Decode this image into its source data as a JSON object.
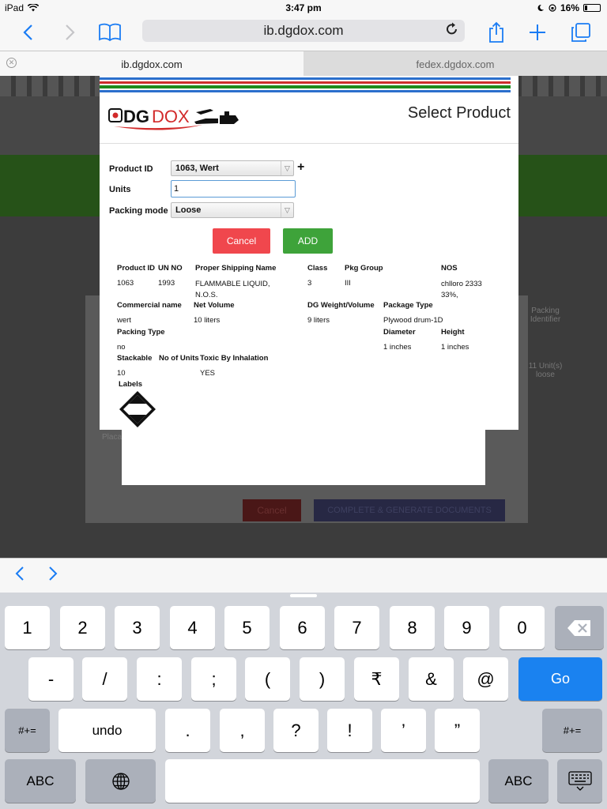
{
  "status_bar": {
    "device": "iPad",
    "wifi": "wifi-icon",
    "time": "3:47 pm",
    "battery": "16%"
  },
  "browser": {
    "url": "ib.dgdox.com",
    "tabs": [
      {
        "label": "ib.dgdox.com",
        "active": true
      },
      {
        "label": "fedex.dgdox.com",
        "active": false
      }
    ]
  },
  "background_page": {
    "packing_identifier_header": "Packing Identifier",
    "row_value": "11 Unit(s) loose",
    "placard_text": "Placa",
    "cancel": "Cancel",
    "complete": "COMPLETE & GENERATE DOCUMENTS"
  },
  "modal": {
    "logo": {
      "dg": "DG",
      "dox": "DOX"
    },
    "title": "Select Product",
    "form": {
      "product_id_label": "Product ID",
      "product_id_value": "1063, Wert",
      "units_label": "Units",
      "units_value": "1",
      "packing_mode_label": "Packing mode",
      "packing_mode_value": "Loose"
    },
    "buttons": {
      "cancel": "Cancel",
      "add": "ADD"
    },
    "details": {
      "product_id_header": "Product ID",
      "un_no_header": "UN NO",
      "shipping_name_header": "Proper Shipping Name",
      "class_header": "Class",
      "pkg_group_header": "Pkg Group",
      "nos_header": "NOS",
      "product_id": "1063",
      "un_no": "1993",
      "shipping_name": "FLAMMABLE LIQUID, N.O.S.",
      "class": "3",
      "pkg_group": "III",
      "nos": "chlloro 2333 33%,",
      "commercial_name_header": "Commercial name",
      "net_volume_header": "Net Volume",
      "dg_weight_header": "DG Weight/Volume",
      "package_type_header": "Package Type",
      "commercial_name": "wert",
      "net_volume": "10 liters",
      "dg_weight": "9 liters",
      "package_type": "Plywood drum-1D",
      "packing_type_header": "Packing Type",
      "diameter_header": "Diameter",
      "height_header": "Height",
      "packing_type": "no",
      "diameter": "1 inches",
      "height": "1 inches",
      "stackable_header": "Stackable",
      "no_of_units_header": "No of Units",
      "toxic_header": "Toxic By Inhalation",
      "stackable": "10",
      "toxic": "YES",
      "labels_header": "Labels"
    }
  },
  "keyboard": {
    "row1": [
      "1",
      "2",
      "3",
      "4",
      "5",
      "6",
      "7",
      "8",
      "9",
      "0"
    ],
    "row2": [
      "-",
      "/",
      ":",
      ";",
      "(",
      ")",
      "₹",
      "&",
      "@"
    ],
    "go": "Go",
    "row3_left": "#+=",
    "undo": "undo",
    "row3": [
      ".",
      ",",
      "?",
      "!",
      "’",
      "”"
    ],
    "row3_right": "#+=",
    "abc": "ABC"
  }
}
